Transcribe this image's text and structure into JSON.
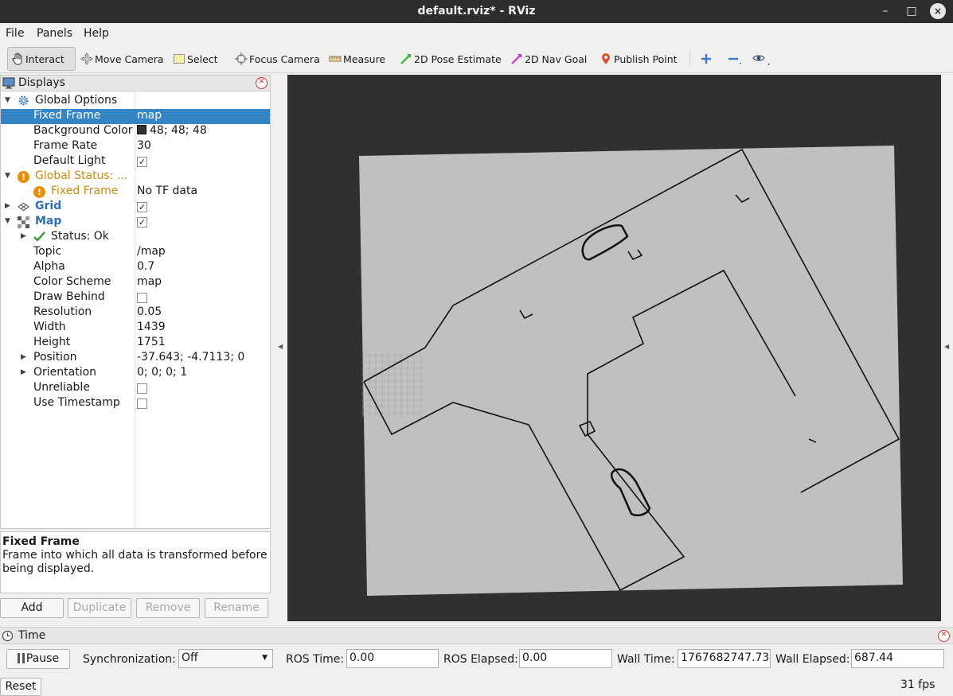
{
  "window": {
    "title": "default.rviz* - RViz",
    "minimize": "–",
    "maximize": "□",
    "close": "×"
  },
  "menu": {
    "file": "File",
    "panels": "Panels",
    "help": "Help"
  },
  "toolbar": {
    "interact": "Interact",
    "move_camera": "Move Camera",
    "select": "Select",
    "focus_camera": "Focus Camera",
    "measure": "Measure",
    "pose_estimate": "2D Pose Estimate",
    "nav_goal": "2D Nav Goal",
    "publish_point": "Publish Point"
  },
  "displays": {
    "title": "Displays",
    "rows": [
      {
        "label": "Global Options"
      },
      {
        "label": "Fixed Frame",
        "value": "map"
      },
      {
        "label": "Background Color",
        "value": "48; 48; 48"
      },
      {
        "label": "Frame Rate",
        "value": "30"
      },
      {
        "label": "Default Light",
        "checked": "✓"
      },
      {
        "label": "Global Status: ..."
      },
      {
        "label": "Fixed Frame",
        "value": "No TF data"
      },
      {
        "label": "Grid",
        "checked": "✓"
      },
      {
        "label": "Map",
        "checked": "✓"
      },
      {
        "label": "Status: Ok"
      },
      {
        "label": "Topic",
        "value": "/map"
      },
      {
        "label": "Alpha",
        "value": "0.7"
      },
      {
        "label": "Color Scheme",
        "value": "map"
      },
      {
        "label": "Draw Behind"
      },
      {
        "label": "Resolution",
        "value": "0.05"
      },
      {
        "label": "Width",
        "value": "1439"
      },
      {
        "label": "Height",
        "value": "1751"
      },
      {
        "label": "Position",
        "value": "-37.643; -4.7113; 0"
      },
      {
        "label": "Orientation",
        "value": "0; 0; 0; 1"
      },
      {
        "label": "Unreliable"
      },
      {
        "label": "Use Timestamp"
      }
    ]
  },
  "description": {
    "title": "Fixed Frame",
    "text": "Frame into which all data is transformed before being displayed."
  },
  "buttons": {
    "add": "Add",
    "duplicate": "Duplicate",
    "remove": "Remove",
    "rename": "Rename"
  },
  "time": {
    "title": "Time",
    "pause": "Pause",
    "sync_label": "Synchronization:",
    "sync_value": "Off",
    "ros_time_label": "ROS Time:",
    "ros_time": "0.00",
    "ros_elapsed_label": "ROS Elapsed:",
    "ros_elapsed": "0.00",
    "wall_time_label": "Wall Time:",
    "wall_time": "1767682747.73",
    "wall_elapsed_label": "Wall Elapsed:",
    "wall_elapsed": "687.44",
    "reset": "Reset",
    "fps": "31 fps"
  },
  "colors": {
    "background": "#303030",
    "selection": "#3584c6",
    "map_free": "#c0c0c0",
    "warning": "#e8900c"
  }
}
